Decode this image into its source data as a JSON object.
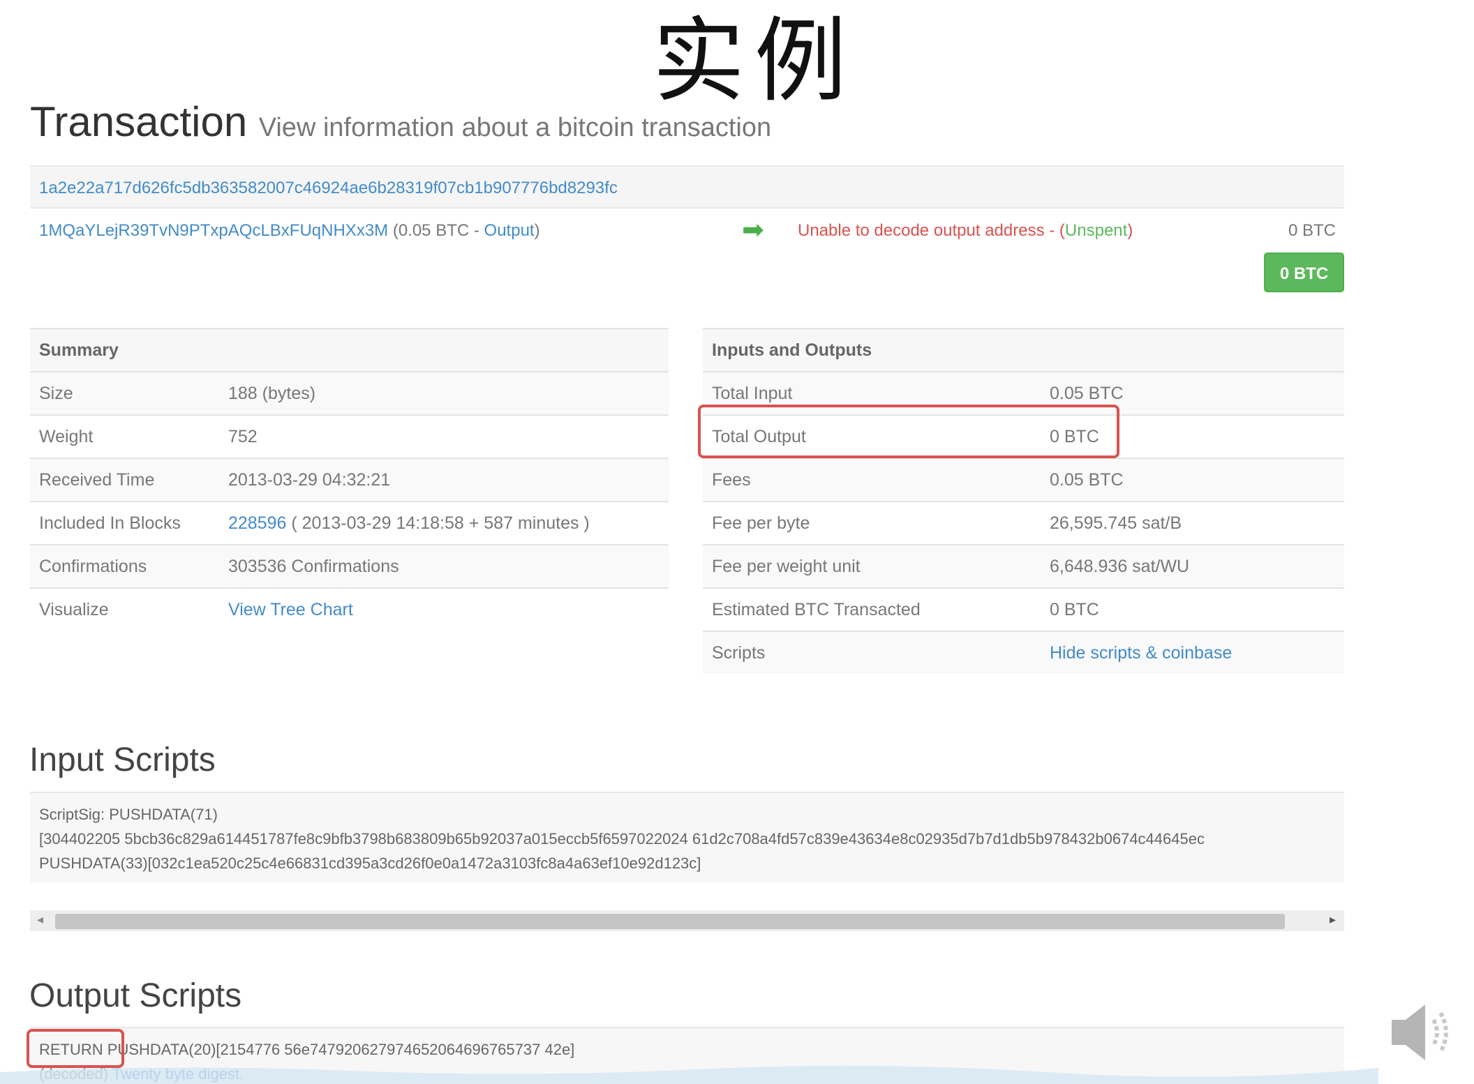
{
  "slide_title": "实例",
  "header": {
    "title": "Transaction",
    "subtitle": "View information about a bitcoin transaction"
  },
  "transaction": {
    "hash": "1a2e22a717d626fc5db363582007c46924ae6b28319f07cb1b907776bd8293fc",
    "input_address": "1MQaYLejR39TvN9PTxpAQcLBxFUqNHXx3M",
    "input_prefix": "(0.05 BTC - ",
    "input_output_link": "Output",
    "input_suffix": ")",
    "output_text": "Unable to decode output address - (",
    "output_status": "Unspent",
    "output_suffix": ")",
    "output_amount": "0 BTC",
    "total_button": "0 BTC"
  },
  "summary": {
    "heading": "Summary",
    "rows": [
      {
        "label": "Size",
        "value": "188 (bytes)"
      },
      {
        "label": "Weight",
        "value": "752"
      },
      {
        "label": "Received Time",
        "value": "2013-03-29 04:32:21"
      },
      {
        "label": "Included In Blocks",
        "block_link": "228596",
        "value": " ( 2013-03-29 14:18:58 + 587 minutes )"
      },
      {
        "label": "Confirmations",
        "value": "303536 Confirmations"
      },
      {
        "label": "Visualize",
        "link": "View Tree Chart"
      }
    ]
  },
  "io": {
    "heading": "Inputs and Outputs",
    "rows": [
      {
        "label": "Total Input",
        "value": "0.05 BTC"
      },
      {
        "label": "Total Output",
        "value": "0 BTC"
      },
      {
        "label": "Fees",
        "value": "0.05 BTC"
      },
      {
        "label": "Fee per byte",
        "value": "26,595.745 sat/B"
      },
      {
        "label": "Fee per weight unit",
        "value": "6,648.936 sat/WU"
      },
      {
        "label": "Estimated BTC Transacted",
        "value": "0 BTC"
      },
      {
        "label": "Scripts",
        "link": "Hide scripts & coinbase"
      }
    ]
  },
  "input_scripts": {
    "heading": "Input Scripts",
    "lines": [
      "ScriptSig: PUSHDATA(71)",
      "[304402205 5bcb36c829a614451787fe8c9bfb3798b683809b65b92037a015eccb5f6597022024 61d2c708a4fd57c839e43634e8c02935d7b7d1db5b978432b0674c44645ec",
      "PUSHDATA(33)[032c1ea520c25c4e66831cd395a3cd26f0e0a1472a3103fc8a4a63ef10e92d123c]"
    ]
  },
  "output_scripts": {
    "heading": "Output Scripts",
    "line": "RETURN PUSHDATA(20)[2154776 56e747920627974652064696765737 42e]",
    "decoded_prefix": "(decoded) ",
    "decoded_link": "Twenty byte digest."
  },
  "colors": {
    "link": "#428bca",
    "success": "#5cb85c",
    "danger": "#d9534f",
    "highlight": "#d9534f"
  },
  "icons": {
    "arrow": "arrow-right-icon",
    "speaker": "speaker-icon"
  }
}
